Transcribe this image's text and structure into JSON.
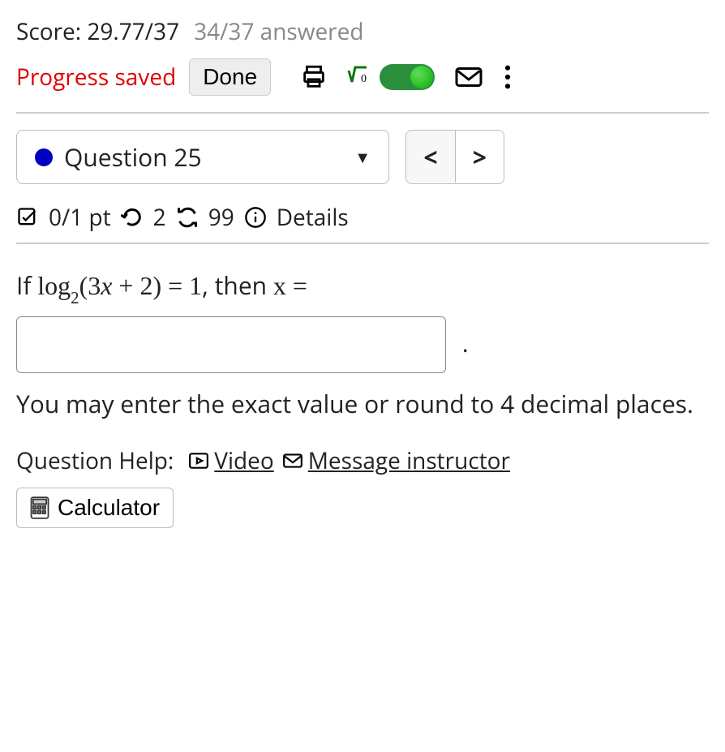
{
  "header": {
    "score_label": "Score: 29.77/37",
    "answered_label": "34/37 answered",
    "progress_saved": "Progress saved",
    "done_label": "Done"
  },
  "question_selector": {
    "label": "Question 25"
  },
  "meta": {
    "points": "0/1 pt",
    "tries": "2",
    "reattempts": "99",
    "details_label": "Details"
  },
  "question": {
    "prefix": "If ",
    "log_text": "log",
    "log_sub": "2",
    "inner": "(3",
    "varx": "x",
    "inner2": " + 2) = 1",
    "suffix1": ", then ",
    "varx2": "x",
    "suffix2": " =",
    "hint": "You may enter the exact value or round to 4 decimal places."
  },
  "help": {
    "label": "Question Help:",
    "video": "Video",
    "message": "Message instructor",
    "calculator": "Calculator"
  }
}
